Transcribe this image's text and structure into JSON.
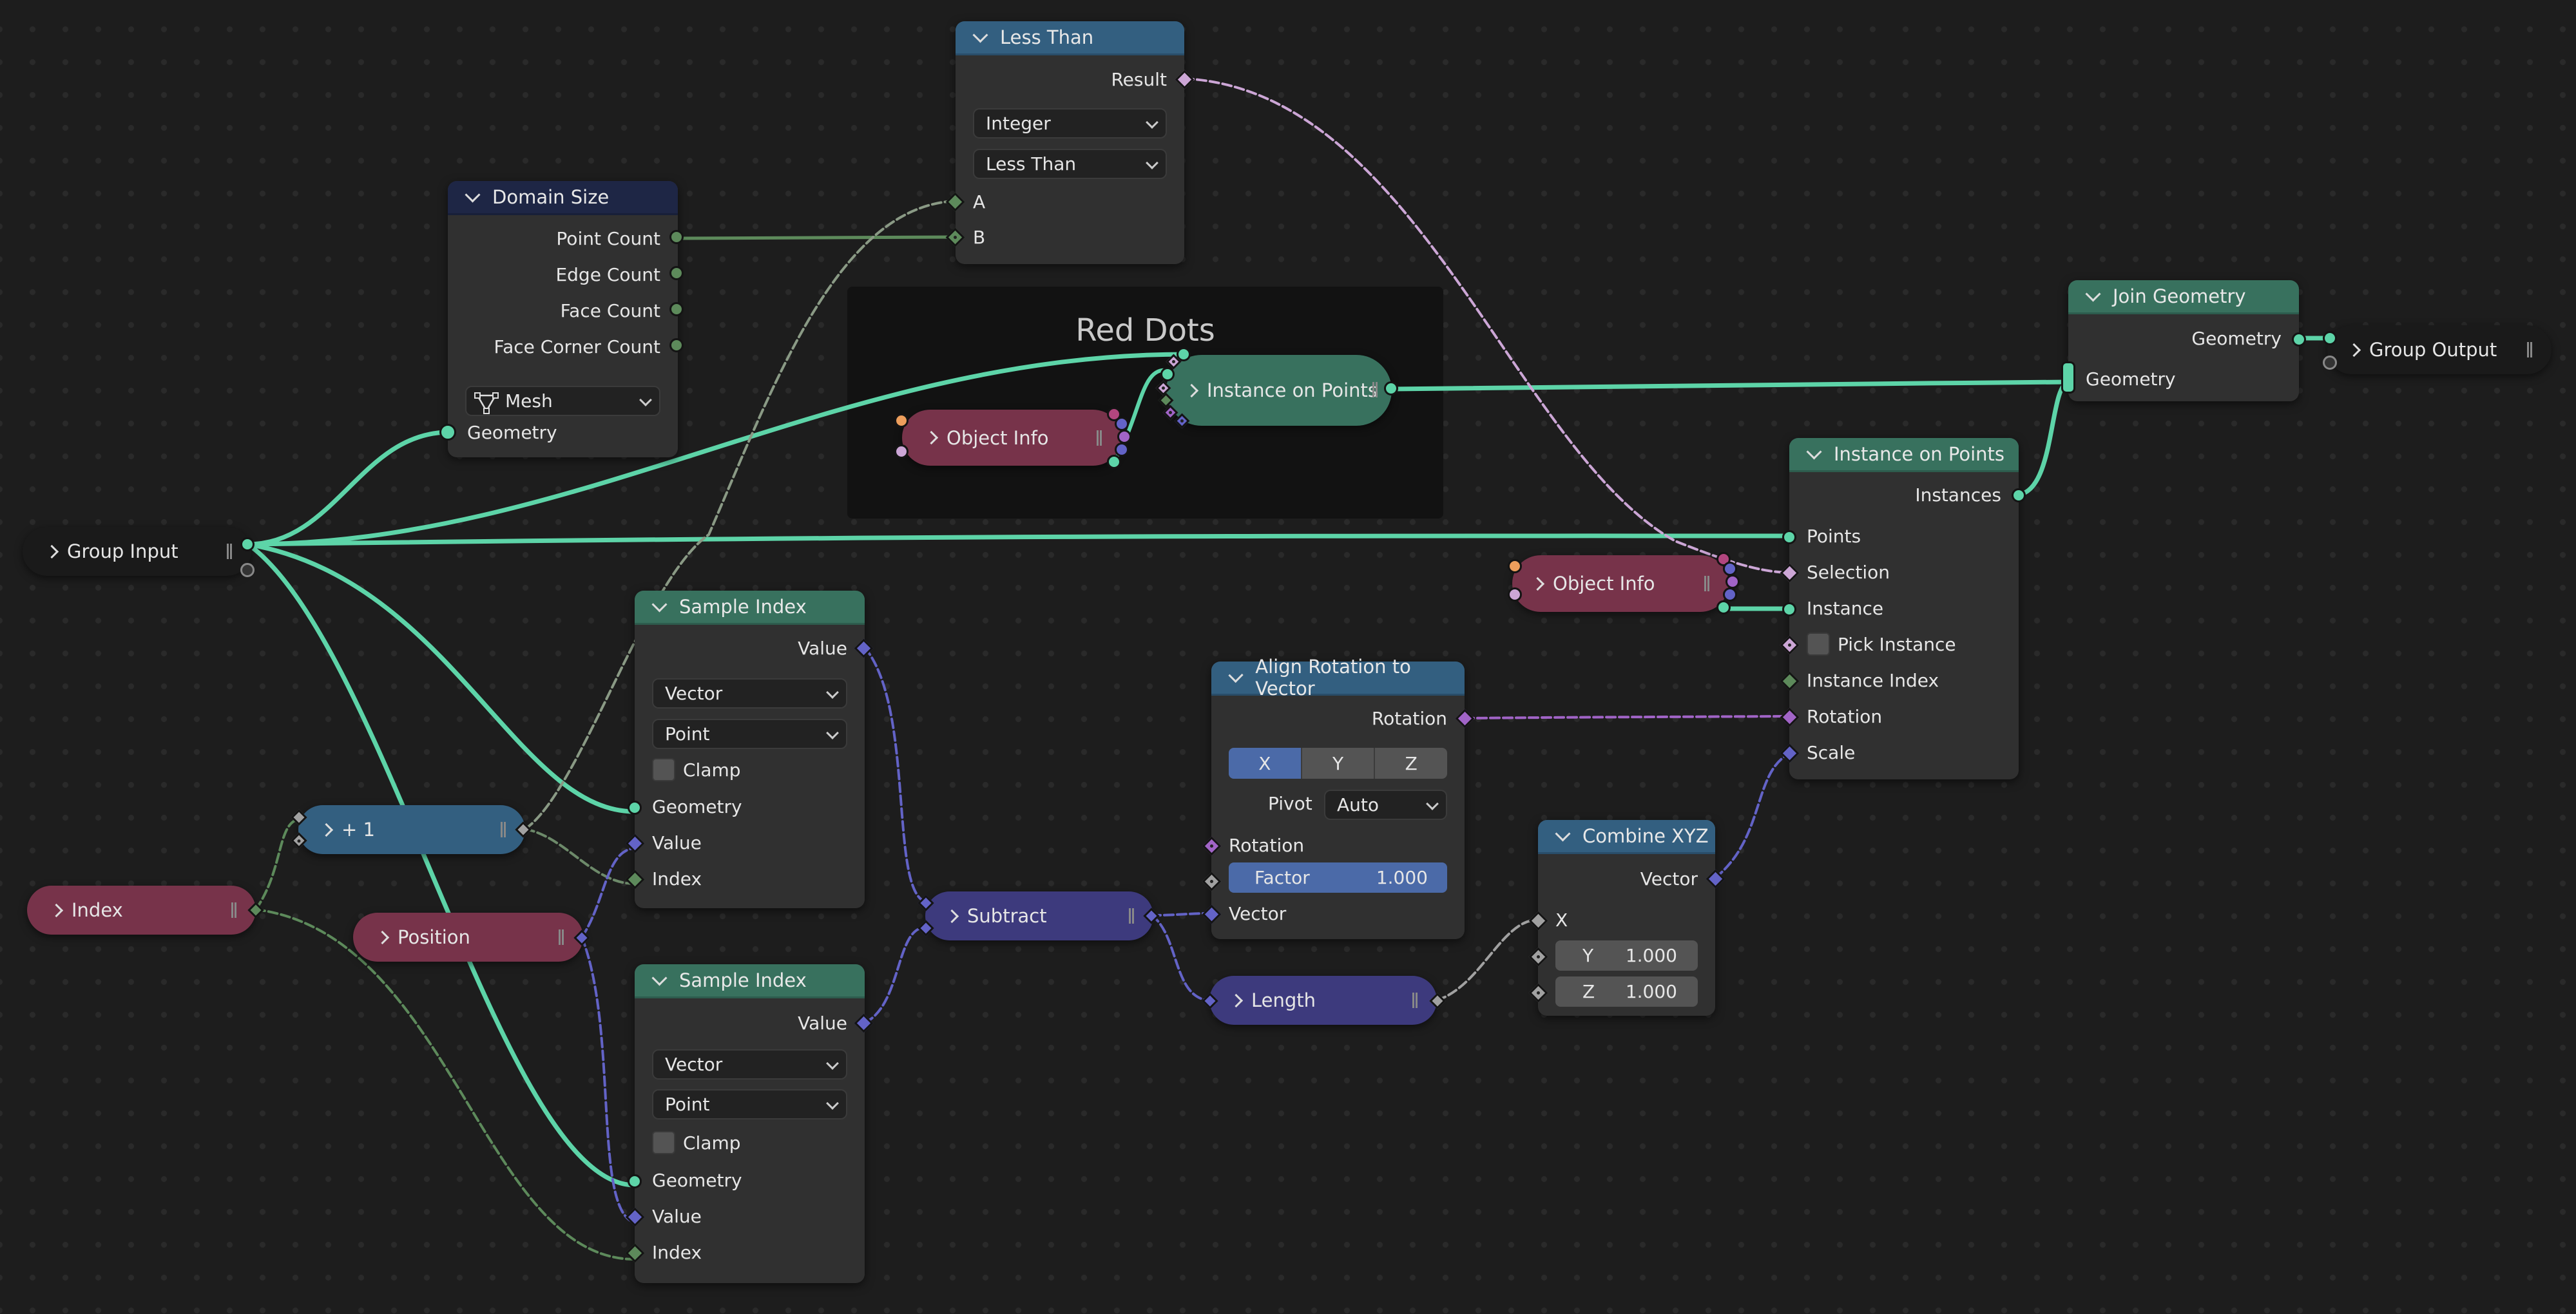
{
  "editor": "Geometry Node Editor",
  "frame": {
    "label": "Red Dots"
  },
  "colors": {
    "background": "#1d1d1d",
    "geometry_socket": "#5dd4a8",
    "integer_socket": "#5d8a5b",
    "vector_socket": "#6363c7",
    "boolean_socket": "#cca6d6",
    "float_socket": "#a1a1a1",
    "rotation_socket": "#a164c7",
    "object_socket": "#ed9e5c",
    "geometry_header": "#38715e",
    "converter_header": "#335f80",
    "input_header": "#1e2645",
    "input_pill": "#77334a",
    "vector_pill": "#3d3a7d",
    "math_pill": "#335f80",
    "selected_field": "#4b6aa8"
  },
  "nodes": {
    "less_than": {
      "title": "Less Than",
      "outputs": [
        "Result"
      ],
      "dropdowns": [
        "Integer",
        "Less Than"
      ],
      "inputs": [
        "A",
        "B"
      ]
    },
    "domain_size": {
      "title": "Domain Size",
      "outputs": [
        "Point Count",
        "Edge Count",
        "Face Count",
        "Face Corner Count"
      ],
      "dropdown": "Mesh",
      "dropdown_icon": "mesh-icon",
      "inputs": [
        "Geometry"
      ]
    },
    "group_input": {
      "title": "Group Input"
    },
    "group_output": {
      "title": "Group Output"
    },
    "object_info_framed": {
      "title": "Object Info"
    },
    "instance_on_points_collapsed": {
      "title": "Instance on Points"
    },
    "join_geometry": {
      "title": "Join Geometry",
      "outputs": [
        "Geometry"
      ],
      "inputs": [
        "Geometry"
      ]
    },
    "instance_on_points": {
      "title": "Instance on Points",
      "outputs": [
        "Instances"
      ],
      "inputs": [
        "Points",
        "Selection",
        "Instance",
        "Pick Instance",
        "Instance Index",
        "Rotation",
        "Scale"
      ],
      "pick_instance_checked": false
    },
    "object_info": {
      "title": "Object Info"
    },
    "sample_index_1": {
      "title": "Sample Index",
      "outputs": [
        "Value"
      ],
      "dropdowns": [
        "Vector",
        "Point"
      ],
      "clamp_label": "Clamp",
      "clamp_checked": false,
      "inputs": [
        "Geometry",
        "Value",
        "Index"
      ]
    },
    "sample_index_2": {
      "title": "Sample Index",
      "outputs": [
        "Value"
      ],
      "dropdowns": [
        "Vector",
        "Point"
      ],
      "clamp_label": "Clamp",
      "clamp_checked": false,
      "inputs": [
        "Geometry",
        "Value",
        "Index"
      ]
    },
    "plus_one": {
      "title": "+ 1"
    },
    "index": {
      "title": "Index"
    },
    "position": {
      "title": "Position"
    },
    "align_rotation": {
      "title": "Align Rotation to Vector",
      "outputs": [
        "Rotation"
      ],
      "axes": [
        "X",
        "Y",
        "Z"
      ],
      "active_axis": "X",
      "pivot_label": "Pivot",
      "pivot_value": "Auto",
      "inputs": [
        "Rotation",
        "Vector"
      ],
      "factor_label": "Factor",
      "factor_value": "1.000"
    },
    "subtract": {
      "title": "Subtract"
    },
    "length": {
      "title": "Length"
    },
    "combine_xyz": {
      "title": "Combine XYZ",
      "outputs": [
        "Vector"
      ],
      "inputs": [
        "X"
      ],
      "y_label": "Y",
      "y_value": "1.000",
      "z_label": "Z",
      "z_value": "1.000"
    }
  }
}
